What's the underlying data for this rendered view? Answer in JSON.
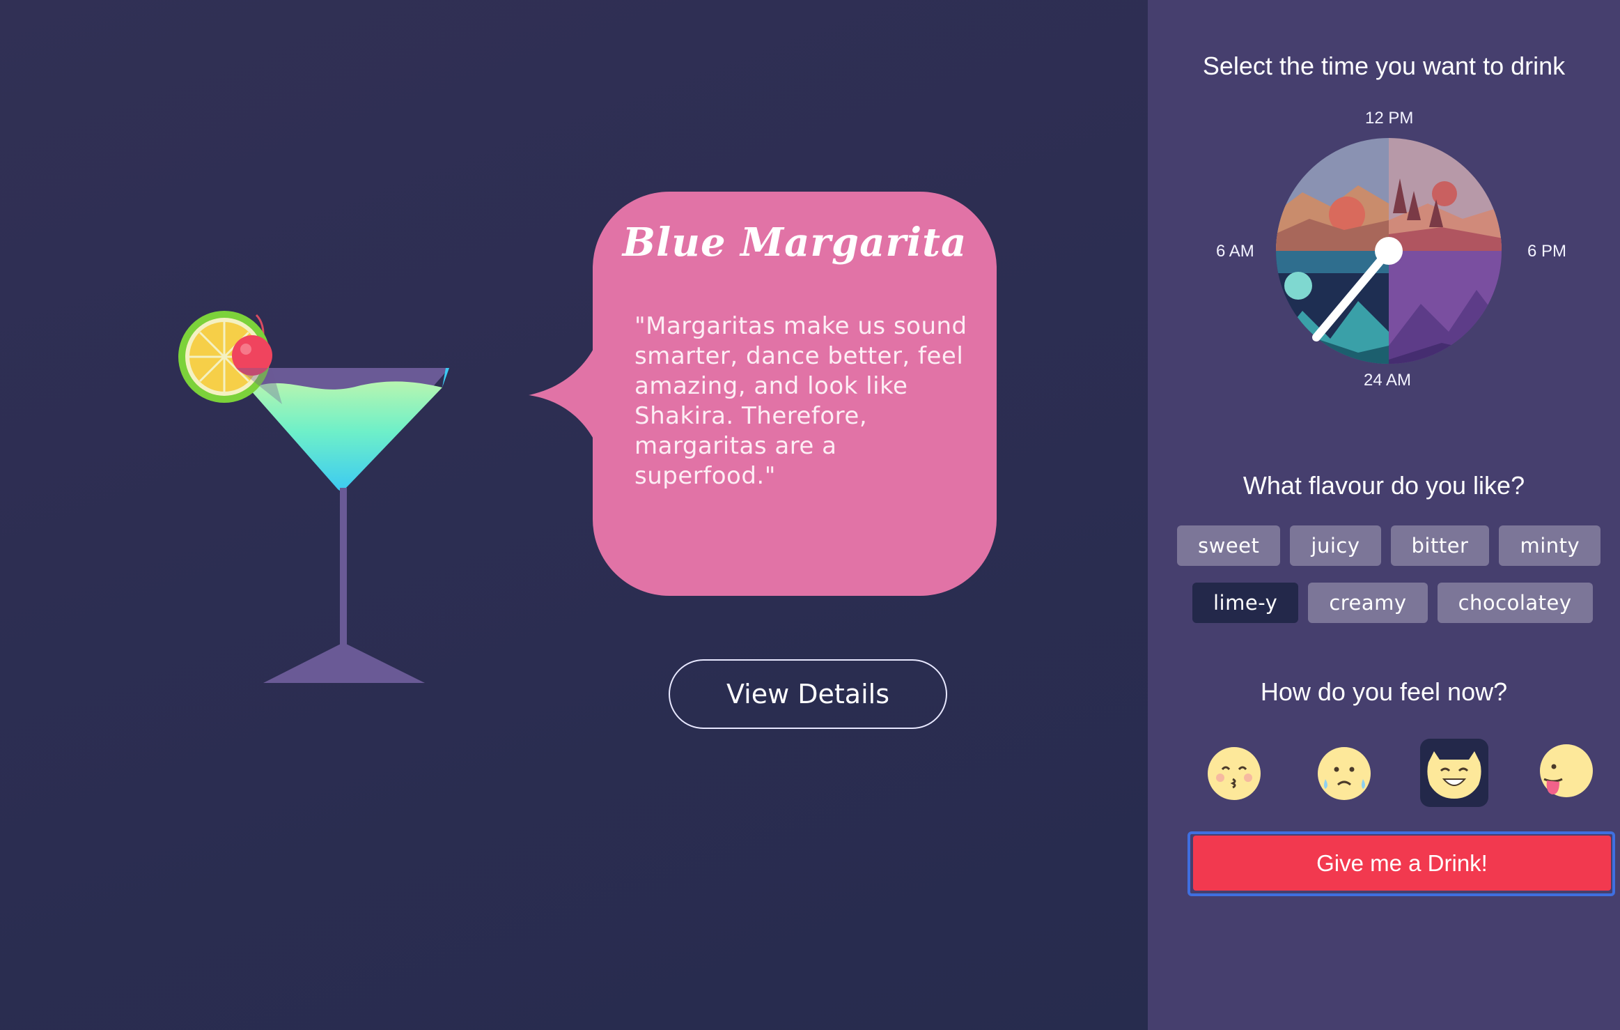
{
  "drink": {
    "name": "Blue Margarita",
    "quote": "\"Margaritas make us sound smarter, dance better, feel amazing, and look like Shakira. Therefore, margaritas are a superfood.\"",
    "view_details_label": "View Details"
  },
  "time_picker": {
    "heading": "Select the time you want to drink",
    "labels": {
      "top": "12 PM",
      "left": "6 AM",
      "right": "6 PM",
      "bottom": "24 AM"
    }
  },
  "flavour": {
    "heading": "What flavour do you like?",
    "options": [
      {
        "label": "sweet",
        "selected": false
      },
      {
        "label": "juicy",
        "selected": false
      },
      {
        "label": "bitter",
        "selected": false
      },
      {
        "label": "minty",
        "selected": false
      },
      {
        "label": "lime-y",
        "selected": true
      },
      {
        "label": "creamy",
        "selected": false
      },
      {
        "label": "chocolatey",
        "selected": false
      }
    ]
  },
  "mood": {
    "heading": "How do you feel now?",
    "options": [
      {
        "icon": "kissing-face-icon",
        "selected": false
      },
      {
        "icon": "crying-face-icon",
        "selected": false
      },
      {
        "icon": "happy-face-icon",
        "selected": true
      },
      {
        "icon": "tongue-out-face-icon",
        "selected": false
      }
    ]
  },
  "cta": {
    "label": "Give me a Drink!"
  },
  "colors": {
    "main_bg": "#2c2e52",
    "sidebar_bg": "#463f6e",
    "bubble": "#e173a6",
    "cta": "#f2394f",
    "tag": "#7c7698",
    "tag_selected": "#23284a"
  }
}
